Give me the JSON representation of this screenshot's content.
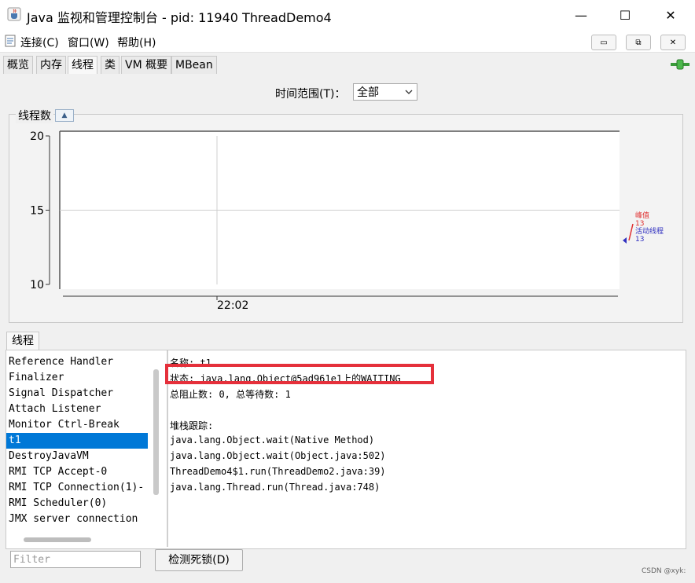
{
  "window": {
    "title": "Java 监视和管理控制台 - pid: 11940 ThreadDemo4",
    "minimize_glyph": "—",
    "maximize_glyph": "☐",
    "close_glyph": "✕"
  },
  "menu": {
    "items": [
      "连接(C)",
      "窗口(W)",
      "帮助(H)"
    ],
    "mdi_buttons": [
      "▭",
      "⧉",
      "✕"
    ]
  },
  "tabs": [
    "概览",
    "内存",
    "线程",
    "类",
    "VM 概要",
    "MBean"
  ],
  "active_tab": "线程",
  "time_range": {
    "label": "时间范围(T)：",
    "value": "全部"
  },
  "chart_panel_title": "线程数",
  "chart_data": {
    "type": "line",
    "yticks": [
      "20",
      "15",
      "10"
    ],
    "ylim": [
      10,
      20
    ],
    "xticks": [
      "22:02"
    ],
    "series": [
      {
        "name": "峰值",
        "values": [
          13
        ],
        "color": "#e03030"
      },
      {
        "name": "活动线程",
        "values": [
          13
        ],
        "color": "#3030c0"
      }
    ],
    "legend_position": "right",
    "grid": true
  },
  "thread_section": {
    "tab_label": "线程",
    "threads": [
      "Reference Handler",
      "Finalizer",
      "Signal Dispatcher",
      "Attach Listener",
      "Monitor Ctrl-Break",
      "t1",
      "DestroyJavaVM",
      "RMI TCP Accept-0",
      "RMI TCP Connection(1)-",
      "RMI Scheduler(0)",
      "JMX server connection"
    ],
    "selected_thread": "t1",
    "details": {
      "name": "名称: t1",
      "state": "状态: java.lang.Object@5ad961e1上的WAITING",
      "counts": "总阻止数: 0, 总等待数: 1",
      "stack_header": "堆栈跟踪:",
      "stack": [
        "java.lang.Object.wait(Native Method)",
        "java.lang.Object.wait(Object.java:502)",
        "ThreadDemo4$1.run(ThreadDemo2.java:39)",
        "java.lang.Thread.run(Thread.java:748)"
      ]
    },
    "filter_placeholder": "Filter",
    "detect_deadlock_label": "检测死锁(D)"
  },
  "watermark": "CSDN @xyk:",
  "colors": {
    "selection": "#0078d7",
    "highlight_box": "#e5303b",
    "peak": "#e03030",
    "live": "#3030c0"
  }
}
